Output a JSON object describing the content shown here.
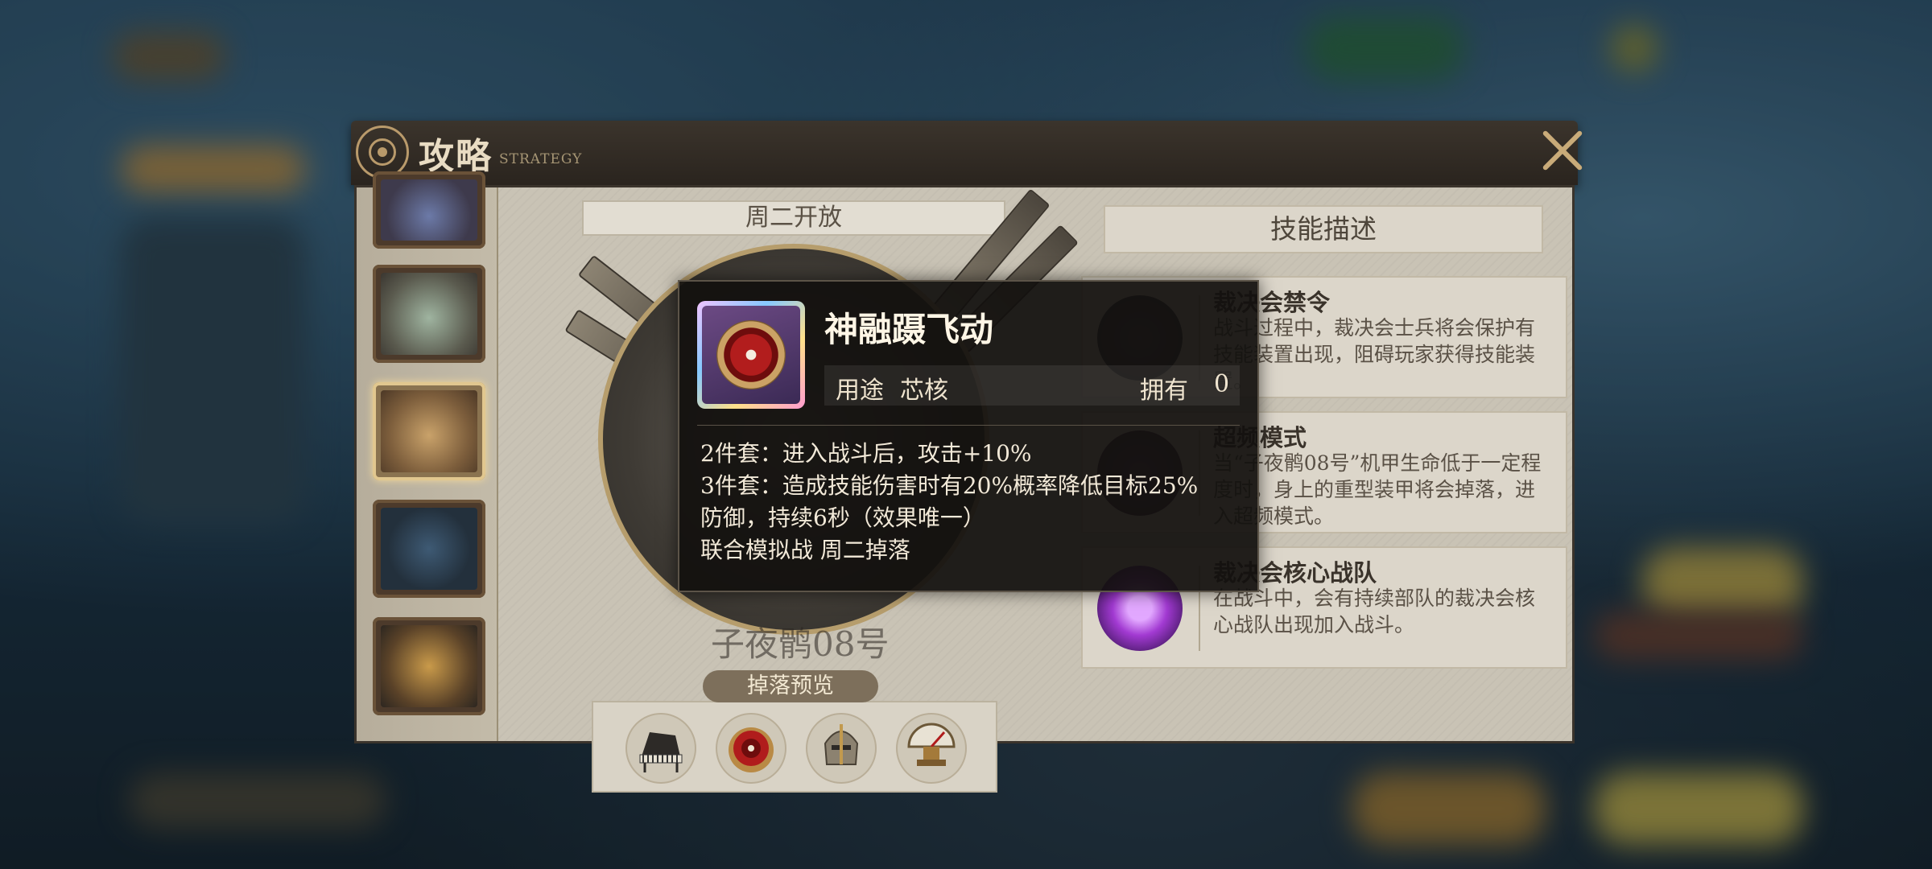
{
  "window": {
    "title": "攻略",
    "subtitle": "STRATEGY"
  },
  "schedule": {
    "open_day": "周二开放"
  },
  "boss": {
    "name_partial": "子夜鹘08号"
  },
  "drops": {
    "tab_label": "掉落预览",
    "items": [
      "piano-item",
      "red-core-item",
      "helmet-item",
      "gauge-item"
    ]
  },
  "skills": {
    "header": "技能描述",
    "list": [
      {
        "name": "裁决会禁令",
        "desc": "战斗过程中，裁决会士兵将会保护有技能装置出现，阻碍玩家获得技能装置。"
      },
      {
        "name": "超频模式",
        "desc": "当“子夜鹘08号”机甲生命低于一定程度时，身上的重型装甲将会掉落，进入超频模式。"
      },
      {
        "name": "裁决会核心战队",
        "desc": "在战斗中，会有持续部队的裁决会核心战队出现加入战斗。"
      }
    ]
  },
  "tooltip": {
    "item_name": "神融蹑飞动",
    "use_label": "用途",
    "use_value": "芯核",
    "own_label": "拥有",
    "own_value": "0",
    "lines": [
      "2件套：进入战斗后，攻击+10%",
      "3件套：造成技能伤害时有20%概率降低目标25%",
      "防御，持续6秒（效果唯一）",
      "联合模拟战 周二掉落"
    ]
  },
  "colors": {
    "panel_frame": "#2a241e",
    "panel_bg": "#c9c3b5",
    "accent_gold": "#c9ab79",
    "tooltip_bg": "#121010"
  }
}
